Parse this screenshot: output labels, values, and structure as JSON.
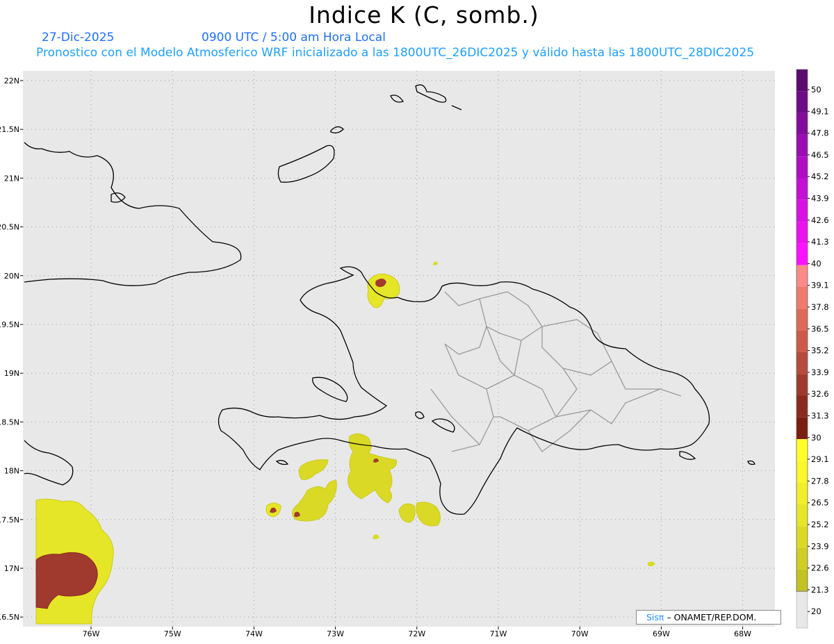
{
  "header": {
    "title": "Indice K (C, somb.)",
    "date": "27-Dic-2025",
    "time": "0900 UTC / 5:00 am Hora Local",
    "model_info": "Pronostico con el Modelo Atmosferico WRF inicializado a las 1800UTC_26DIC2025 y válido hasta las  1800UTC_28DIC2025"
  },
  "map": {
    "background_color": "#e8e8e8",
    "lat_labels": [
      "22N",
      "21.5N",
      "21N",
      "20.5N",
      "20N",
      "19.5N",
      "19N",
      "18.5N",
      "18N",
      "17.5N",
      "17N",
      "16.5N"
    ],
    "lon_labels": [
      "76W",
      "75W",
      "74W",
      "73W",
      "72W",
      "71W",
      "70W",
      "69W",
      "68W"
    ],
    "grid": "dotted",
    "regions": [
      "Haiti",
      "Dominican Republic",
      "Cuba",
      "Jamaica",
      "Bahamas",
      "Turks and Caicos"
    ]
  },
  "colorbar": {
    "labels": [
      "50",
      "49.1",
      "47.8",
      "46.5",
      "45.2",
      "43.9",
      "42.6",
      "41.3",
      "40",
      "39.1",
      "37.8",
      "36.5",
      "35.2",
      "33.9",
      "32.6",
      "31.3",
      "30",
      "29.1",
      "27.8",
      "26.5",
      "25.2",
      "23.9",
      "22.6",
      "21.3",
      "20"
    ],
    "colors": [
      "#5a0a6e",
      "#6e0b86",
      "#830c9c",
      "#9a0db2",
      "#b00dc4",
      "#c40fd4",
      "#d811e2",
      "#eb12ee",
      "#ff12ff",
      "#ff8a8a",
      "#ef7a6e",
      "#de6a5a",
      "#cc5a4a",
      "#b64a3c",
      "#a03a2e",
      "#8a2a1e",
      "#7a1e10",
      "#ffff2a",
      "#f8f82a",
      "#f0f02a",
      "#e6e628",
      "#dada26",
      "#cece24",
      "#c2c222"
    ]
  },
  "credit": {
    "brand": "Sisπ",
    "org": "– ONAMET/REP.DOM."
  }
}
